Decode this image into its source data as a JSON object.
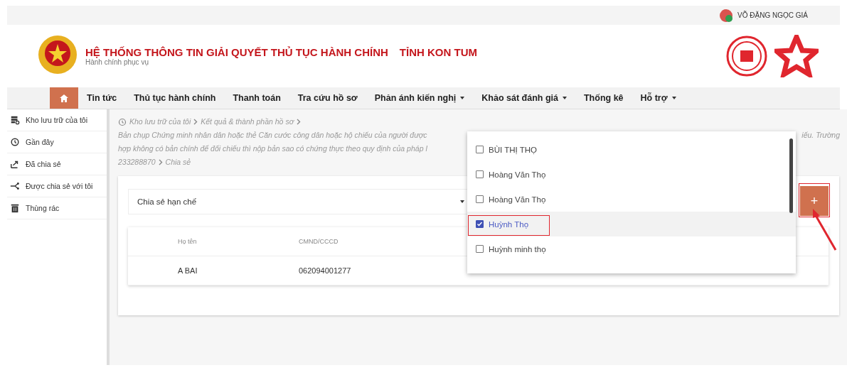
{
  "user": {
    "name": "VÕ ĐẶNG NGỌC GIÁ"
  },
  "header": {
    "title": "HỆ THỐNG THÔNG TIN GIẢI QUYẾT THỦ TỤC HÀNH CHÍNH",
    "province": "TỈNH KON TUM",
    "subtitle": "Hành chính phục vụ"
  },
  "nav": [
    {
      "label": "Tin tức",
      "dropdown": false
    },
    {
      "label": "Thủ tục hành chính",
      "dropdown": false
    },
    {
      "label": "Thanh toán",
      "dropdown": false
    },
    {
      "label": "Tra cứu hồ sơ",
      "dropdown": false
    },
    {
      "label": "Phản ánh kiến nghị",
      "dropdown": true
    },
    {
      "label": "Khảo sát đánh giá",
      "dropdown": true
    },
    {
      "label": "Thống kê",
      "dropdown": false
    },
    {
      "label": "Hỗ trợ",
      "dropdown": true
    }
  ],
  "sidebar": {
    "items": [
      {
        "label": "Kho lưu trữ của tôi"
      },
      {
        "label": "Gần đây"
      },
      {
        "label": "Đã chia sẻ"
      },
      {
        "label": "Được chia sẻ với tôi"
      },
      {
        "label": "Thùng rác"
      }
    ]
  },
  "breadcrumb": {
    "items": [
      "Kho lưu trữ của tôi",
      "Kết quả & thành phần hồ sơ"
    ],
    "line_1": "Bản chụp Chứng minh nhân dân hoặc thẻ Căn cước công dân hoặc hộ chiếu của người được",
    "line_1_end": "iếu. Trường",
    "line_2": "hợp không có bản chính để đối chiếu thì nộp bản sao có chứng thực theo quy định của pháp l",
    "line_3": "233288870",
    "current": "Chia sẻ"
  },
  "share_mode": {
    "value": "Chia sẻ hạn chế"
  },
  "add_button": {
    "label": "+"
  },
  "table": {
    "columns": [
      "Họ tên",
      "CMND/CCCD"
    ],
    "rows": [
      [
        "A BAI",
        "062094001277"
      ]
    ]
  },
  "dropdown": {
    "options": [
      {
        "label": "BÙI THỊ THỌ",
        "selected": false
      },
      {
        "label": "Hoàng Văn Thọ",
        "selected": false
      },
      {
        "label": "Hoàng Văn Thọ",
        "selected": false
      },
      {
        "label": "Huỳnh Thọ",
        "selected": true
      },
      {
        "label": "Huỳnh minh thọ",
        "selected": false
      }
    ]
  }
}
